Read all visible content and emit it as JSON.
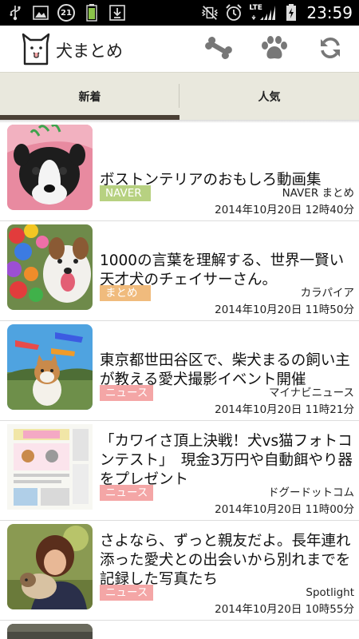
{
  "status_bar": {
    "time": "23:59",
    "notification_count": "21",
    "network": "LTE"
  },
  "app_bar": {
    "title": "犬まとめ",
    "actions": [
      "bone-icon",
      "paw-icon",
      "refresh-icon"
    ]
  },
  "tabs": [
    {
      "label": "新着",
      "selected": true
    },
    {
      "label": "人気",
      "selected": false
    }
  ],
  "colors": {
    "tab_indicator": "#4a4035",
    "tab_bg": "#e9e8dd",
    "tag_naver": "#b7d181",
    "tag_matome": "#f0bb7d",
    "tag_news": "#f4a6a6"
  },
  "articles": [
    {
      "title": "ボストンテリアのおもしろ動画集",
      "tag": "NAVER",
      "tag_type": "naver",
      "source": "NAVER まとめ",
      "date": "2014年10月20日 12時40分"
    },
    {
      "title": "1000の言葉を理解する、世界一賢い天才犬のチェイサーさん。",
      "tag": "まとめ",
      "tag_type": "matome",
      "source": "カラパイア",
      "date": "2014年10月20日 11時50分"
    },
    {
      "title": "東京都世田谷区で、柴犬まるの飼い主が教える愛犬撮影イベント開催",
      "tag": "ニュース",
      "tag_type": "news",
      "source": "マイナビニュース",
      "date": "2014年10月20日 11時21分"
    },
    {
      "title": "「カワイさ頂上決戦！犬vs猫フォトコンテスト」　現金3万円や自動餌やり器をプレゼント",
      "tag": "ニュース",
      "tag_type": "news",
      "source": "ドグードットコム",
      "date": "2014年10月20日 11時00分"
    },
    {
      "title": "さよなら、ずっと親友だよ。長年連れ添った愛犬との出会いから別れまでを記録した写真たち",
      "tag": "ニュース",
      "tag_type": "news",
      "source": "Spotlight",
      "date": "2014年10月20日 10時55分"
    }
  ]
}
